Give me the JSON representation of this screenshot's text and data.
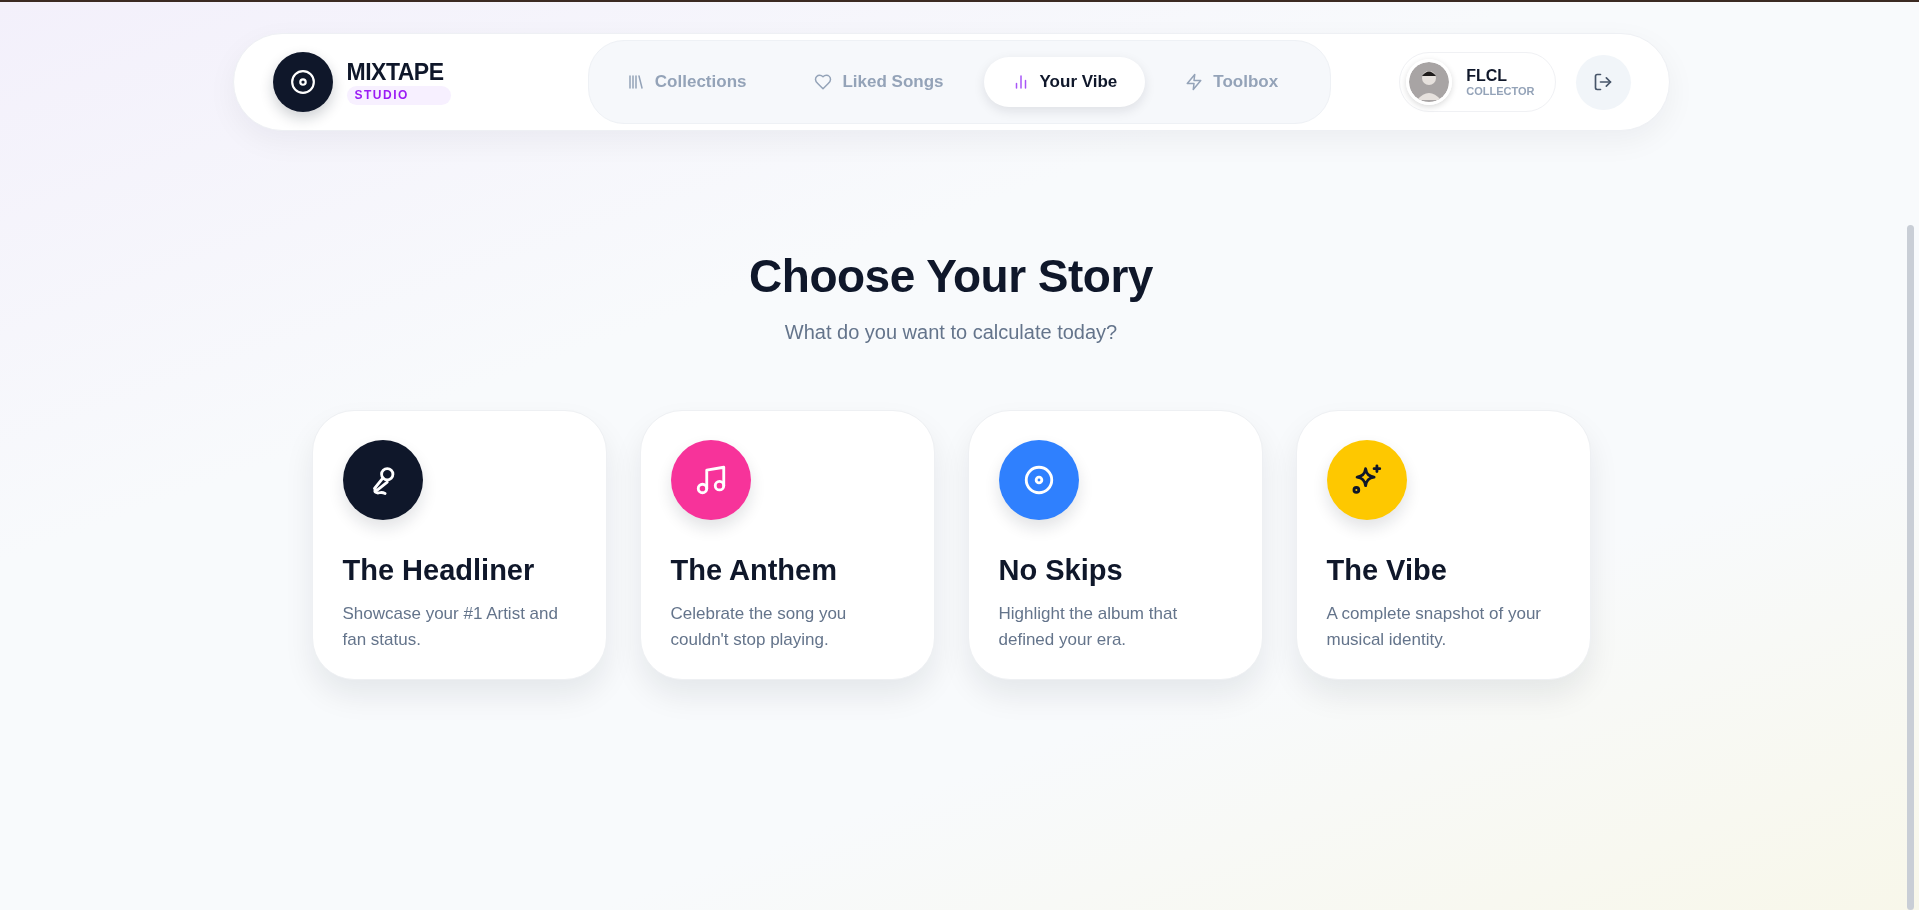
{
  "brand": {
    "name": "MIXTAPE",
    "badge": "STUDIO"
  },
  "nav": [
    {
      "label": "Collections",
      "selected": false
    },
    {
      "label": "Liked Songs",
      "selected": false
    },
    {
      "label": "Your Vibe",
      "selected": true
    },
    {
      "label": "Toolbox",
      "selected": false
    }
  ],
  "user": {
    "name": "FLCL",
    "role": "COLLECTOR"
  },
  "heading": {
    "title": "Choose Your Story",
    "subtitle": "What do you want to calculate today?"
  },
  "cards": [
    {
      "title": "The Headliner",
      "description": "Showcase your #1 Artist and fan status.",
      "color": "#0f172a"
    },
    {
      "title": "The Anthem",
      "description": "Celebrate the song you couldn't stop playing.",
      "color": "#f7339a"
    },
    {
      "title": "No Skips",
      "description": "Highlight the album that defined your era.",
      "color": "#2f80fe"
    },
    {
      "title": "The Vibe",
      "description": "A complete snapshot of your musical identity.",
      "color": "#fec800"
    }
  ]
}
